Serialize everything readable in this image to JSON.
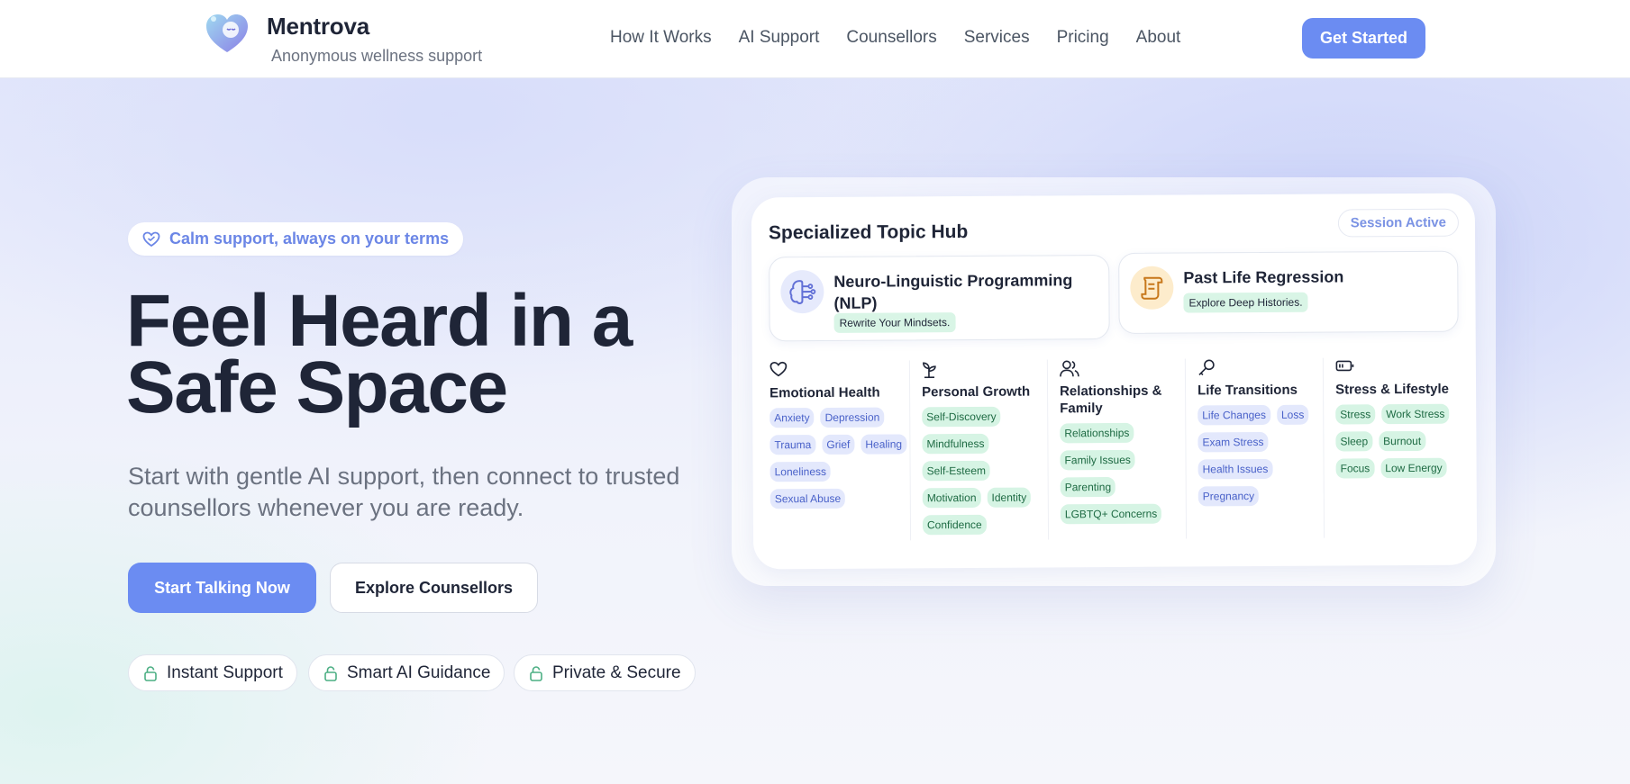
{
  "header": {
    "brand_name": "Mentrova",
    "brand_tagline": "Anonymous wellness support",
    "nav": [
      "How It Works",
      "AI Support",
      "Counsellors",
      "Services",
      "Pricing",
      "About"
    ],
    "cta_label": "Get Started"
  },
  "hero": {
    "pill": "Calm support, always on your terms",
    "headline_line1": "Feel Heard in a",
    "headline_line2": "Safe Space",
    "subtext": "Start with gentle AI support, then connect to trusted counsellors whenever you are ready.",
    "primary_button": "Start Talking Now",
    "secondary_button": "Explore Counsellors",
    "features": [
      "Instant Support",
      "Smart AI Guidance",
      "Private & Secure"
    ]
  },
  "card": {
    "title": "Specialized Topic Hub",
    "status": "Session Active",
    "topics": [
      {
        "title_line1": "Neuro-Linguistic Programming",
        "title_line2": "(NLP)",
        "tag": "Rewrite Your Mindsets.",
        "icon": "brain-icon"
      },
      {
        "title_line1": "Past Life Regression",
        "tag": "Explore Deep Histories.",
        "icon": "scroll-icon"
      }
    ],
    "categories": [
      {
        "title": "Emotional Health",
        "icon": "heart-icon",
        "tags": [
          "Anxiety",
          "Depression",
          "Trauma",
          "Grief",
          "Healing",
          "Loneliness",
          "Sexual Abuse"
        ]
      },
      {
        "title": "Personal Growth",
        "icon": "sprout-icon",
        "tags": [
          "Self-Discovery",
          "Mindfulness",
          "Self-Esteem",
          "Motivation",
          "Identity",
          "Confidence"
        ]
      },
      {
        "title": "Relationships & Family",
        "icon": "users-icon",
        "tags": [
          "Relationships",
          "Family Issues",
          "Parenting",
          "LGBTQ+ Concerns"
        ]
      },
      {
        "title": "Life Transitions",
        "icon": "key-icon",
        "tags": [
          "Life Changes",
          "Loss",
          "Exam Stress",
          "Health Issues",
          "Pregnancy"
        ]
      },
      {
        "title": "Stress & Lifestyle",
        "icon": "battery-icon",
        "tags": [
          "Stress",
          "Work Stress",
          "Sleep",
          "Burnout",
          "Focus",
          "Low Energy"
        ]
      }
    ]
  },
  "colors": {
    "accent": "#6b8cf2",
    "tag_blue_bg": "#e3e8fc",
    "tag_green_bg": "#d6f4e4"
  }
}
